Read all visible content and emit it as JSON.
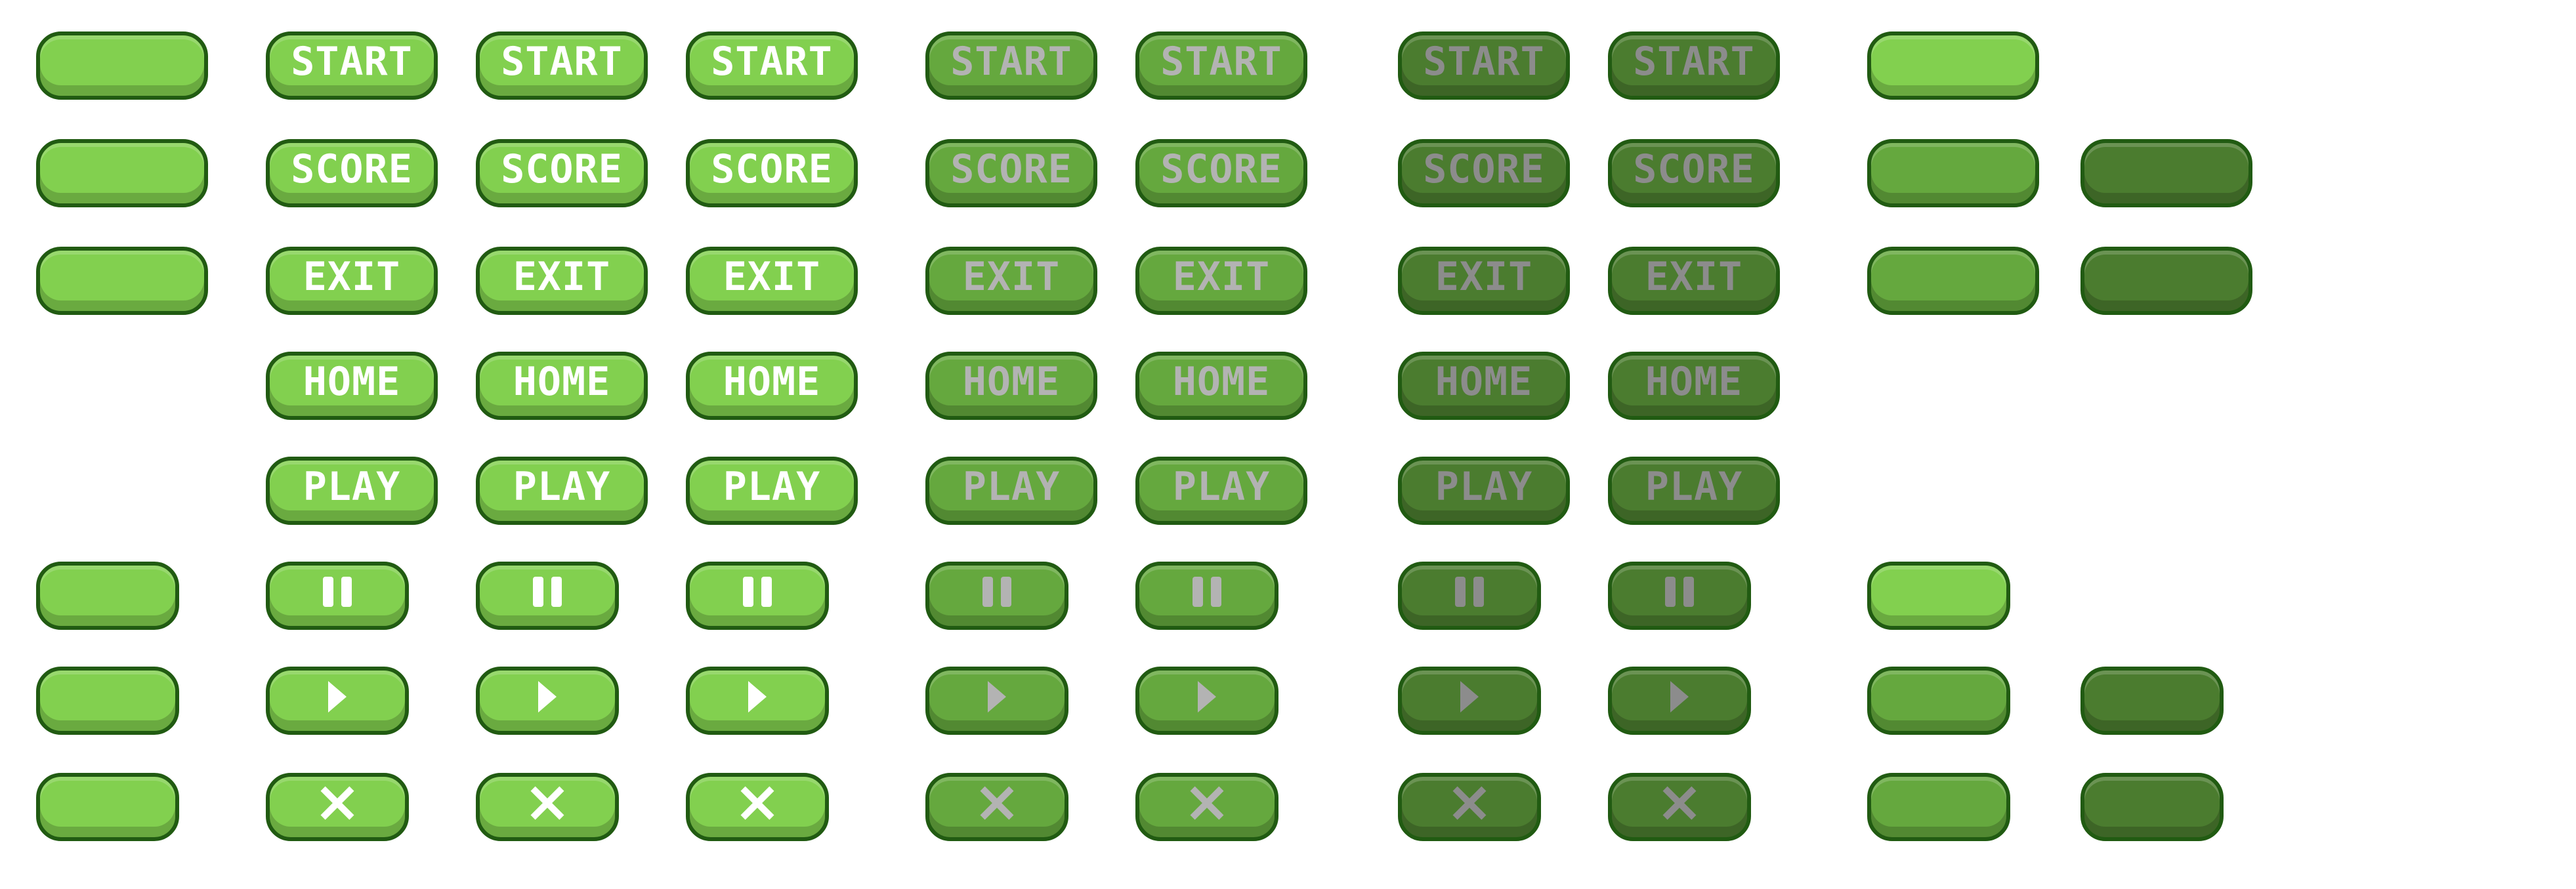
{
  "sheet": {
    "columns": [
      {
        "shade": "light",
        "width": "wide",
        "rows": [
          {
            "kind": "blank"
          },
          {
            "kind": "blank"
          },
          {
            "kind": "blank"
          },
          {
            "kind": "empty"
          },
          {
            "kind": "empty"
          },
          {
            "kind": "blank"
          },
          {
            "kind": "blank"
          },
          {
            "kind": "blank"
          }
        ]
      },
      {
        "shade": "light",
        "width": "wide",
        "rows": [
          {
            "kind": "label",
            "text": "START"
          },
          {
            "kind": "label",
            "text": "SCORE"
          },
          {
            "kind": "label",
            "text": "EXIT"
          },
          {
            "kind": "label",
            "text": "HOME"
          },
          {
            "kind": "label",
            "text": "PLAY"
          },
          {
            "kind": "icon",
            "icon": "pause-icon"
          },
          {
            "kind": "icon",
            "icon": "play-icon"
          },
          {
            "kind": "icon",
            "icon": "close-icon"
          }
        ]
      },
      {
        "shade": "light",
        "width": "wide",
        "rows": [
          {
            "kind": "label",
            "text": "START"
          },
          {
            "kind": "label",
            "text": "SCORE"
          },
          {
            "kind": "label",
            "text": "EXIT"
          },
          {
            "kind": "label",
            "text": "HOME"
          },
          {
            "kind": "label",
            "text": "PLAY"
          },
          {
            "kind": "icon",
            "icon": "pause-icon"
          },
          {
            "kind": "icon",
            "icon": "play-icon"
          },
          {
            "kind": "icon",
            "icon": "close-icon"
          }
        ]
      },
      {
        "shade": "light",
        "width": "wide",
        "rows": [
          {
            "kind": "label",
            "text": "START"
          },
          {
            "kind": "label",
            "text": "SCORE"
          },
          {
            "kind": "label",
            "text": "EXIT"
          },
          {
            "kind": "label",
            "text": "HOME"
          },
          {
            "kind": "label",
            "text": "PLAY"
          },
          {
            "kind": "icon",
            "icon": "pause-icon"
          },
          {
            "kind": "icon",
            "icon": "play-icon"
          },
          {
            "kind": "icon",
            "icon": "close-icon"
          }
        ]
      },
      {
        "shade": "mid",
        "width": "wide",
        "rows": [
          {
            "kind": "label",
            "text": "START"
          },
          {
            "kind": "label",
            "text": "SCORE"
          },
          {
            "kind": "label",
            "text": "EXIT"
          },
          {
            "kind": "label",
            "text": "HOME"
          },
          {
            "kind": "label",
            "text": "PLAY"
          },
          {
            "kind": "icon",
            "icon": "pause-icon"
          },
          {
            "kind": "icon",
            "icon": "play-icon"
          },
          {
            "kind": "icon",
            "icon": "close-icon"
          }
        ]
      },
      {
        "shade": "mid",
        "width": "wide",
        "rows": [
          {
            "kind": "label",
            "text": "START"
          },
          {
            "kind": "label",
            "text": "SCORE"
          },
          {
            "kind": "label",
            "text": "EXIT"
          },
          {
            "kind": "label",
            "text": "HOME"
          },
          {
            "kind": "label",
            "text": "PLAY"
          },
          {
            "kind": "icon",
            "icon": "pause-icon"
          },
          {
            "kind": "icon",
            "icon": "play-icon"
          },
          {
            "kind": "icon",
            "icon": "close-icon"
          }
        ]
      },
      {
        "shade": "dark",
        "width": "wide",
        "rows": [
          {
            "kind": "label",
            "text": "START"
          },
          {
            "kind": "label",
            "text": "SCORE"
          },
          {
            "kind": "label",
            "text": "EXIT"
          },
          {
            "kind": "label",
            "text": "HOME"
          },
          {
            "kind": "label",
            "text": "PLAY"
          },
          {
            "kind": "icon",
            "icon": "pause-icon"
          },
          {
            "kind": "icon",
            "icon": "play-icon"
          },
          {
            "kind": "icon",
            "icon": "close-icon"
          }
        ]
      },
      {
        "shade": "dark",
        "width": "wide",
        "rows": [
          {
            "kind": "label",
            "text": "START"
          },
          {
            "kind": "label",
            "text": "SCORE"
          },
          {
            "kind": "label",
            "text": "EXIT"
          },
          {
            "kind": "label",
            "text": "HOME"
          },
          {
            "kind": "label",
            "text": "PLAY"
          },
          {
            "kind": "icon",
            "icon": "pause-icon"
          },
          {
            "kind": "icon",
            "icon": "play-icon"
          },
          {
            "kind": "icon",
            "icon": "close-icon"
          }
        ]
      },
      {
        "shade": "mixed",
        "width": "wide",
        "rows": [
          {
            "kind": "blank",
            "shade": "light"
          },
          {
            "kind": "blank",
            "shade": "mid"
          },
          {
            "kind": "blank",
            "shade": "mid"
          },
          {
            "kind": "empty"
          },
          {
            "kind": "empty"
          },
          {
            "kind": "blank",
            "shade": "light"
          },
          {
            "kind": "blank",
            "shade": "mid"
          },
          {
            "kind": "blank",
            "shade": "mid"
          }
        ]
      },
      {
        "shade": "dark",
        "width": "wide",
        "rows": [
          {
            "kind": "empty"
          },
          {
            "kind": "blank"
          },
          {
            "kind": "blank"
          },
          {
            "kind": "empty"
          },
          {
            "kind": "empty"
          },
          {
            "kind": "empty"
          },
          {
            "kind": "blank"
          },
          {
            "kind": "blank"
          }
        ]
      }
    ]
  },
  "colors": {
    "light_fill": "#82d04f",
    "mid_fill": "#65a83e",
    "dark_fill": "#4b7c2f",
    "outline": "#215b12",
    "light_text": "#ffffff",
    "mid_text": "#b3b3b3",
    "dark_text": "#8c8c8c"
  }
}
